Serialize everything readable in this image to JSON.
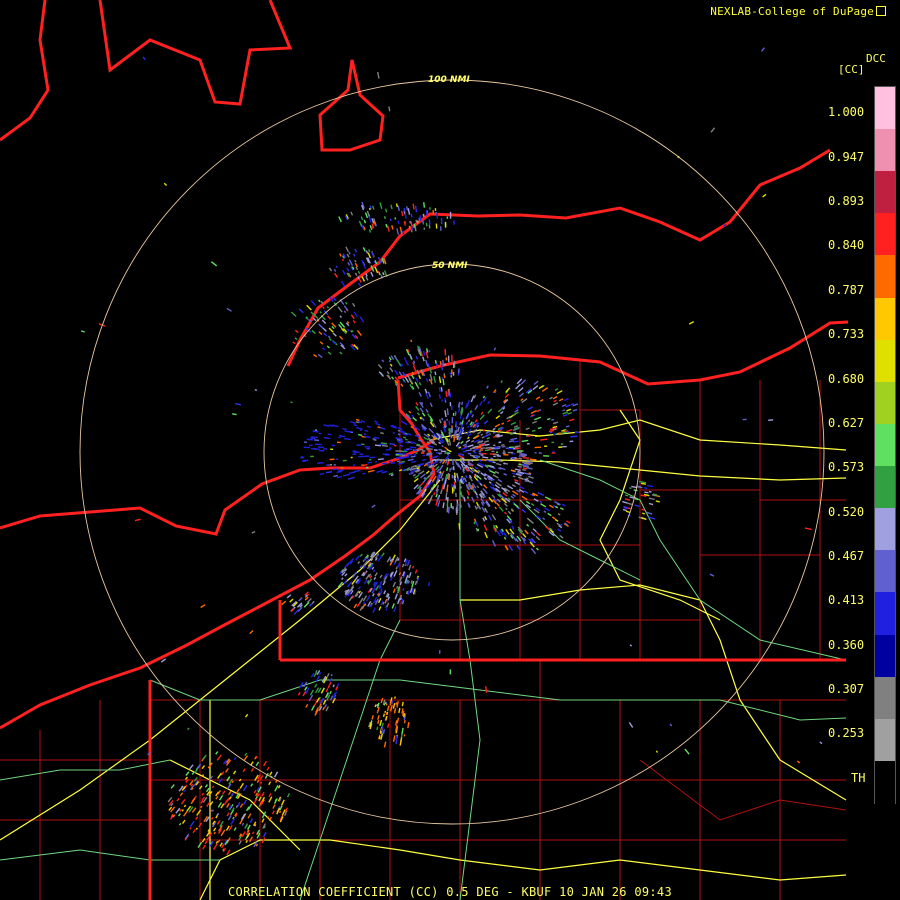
{
  "header": {
    "credit": "NEXLAB-College of DuPage"
  },
  "legend": {
    "product_code": "DCC",
    "unit": "[CC]",
    "ticks": [
      "1.000",
      "0.947",
      "0.893",
      "0.840",
      "0.787",
      "0.733",
      "0.680",
      "0.627",
      "0.573",
      "0.520",
      "0.467",
      "0.413",
      "0.360",
      "0.307",
      "0.253",
      "TH"
    ],
    "colors": [
      "#ffc0e0",
      "#f090b0",
      "#c02040",
      "#ff2020",
      "#ff6a00",
      "#ffc800",
      "#e0e000",
      "#a0d020",
      "#60e060",
      "#30a040",
      "#a0a0e0",
      "#6060d0",
      "#2020e0",
      "#0000a0",
      "#808080",
      "#a0a0a0",
      "#000000"
    ]
  },
  "rings": [
    {
      "label": "100 NMI"
    },
    {
      "label": "50 NMI"
    }
  ],
  "footer": {
    "text": "CORRELATION COEFFICIENT (CC) 0.5 DEG - KBUF 10 JAN 26 09:43"
  }
}
